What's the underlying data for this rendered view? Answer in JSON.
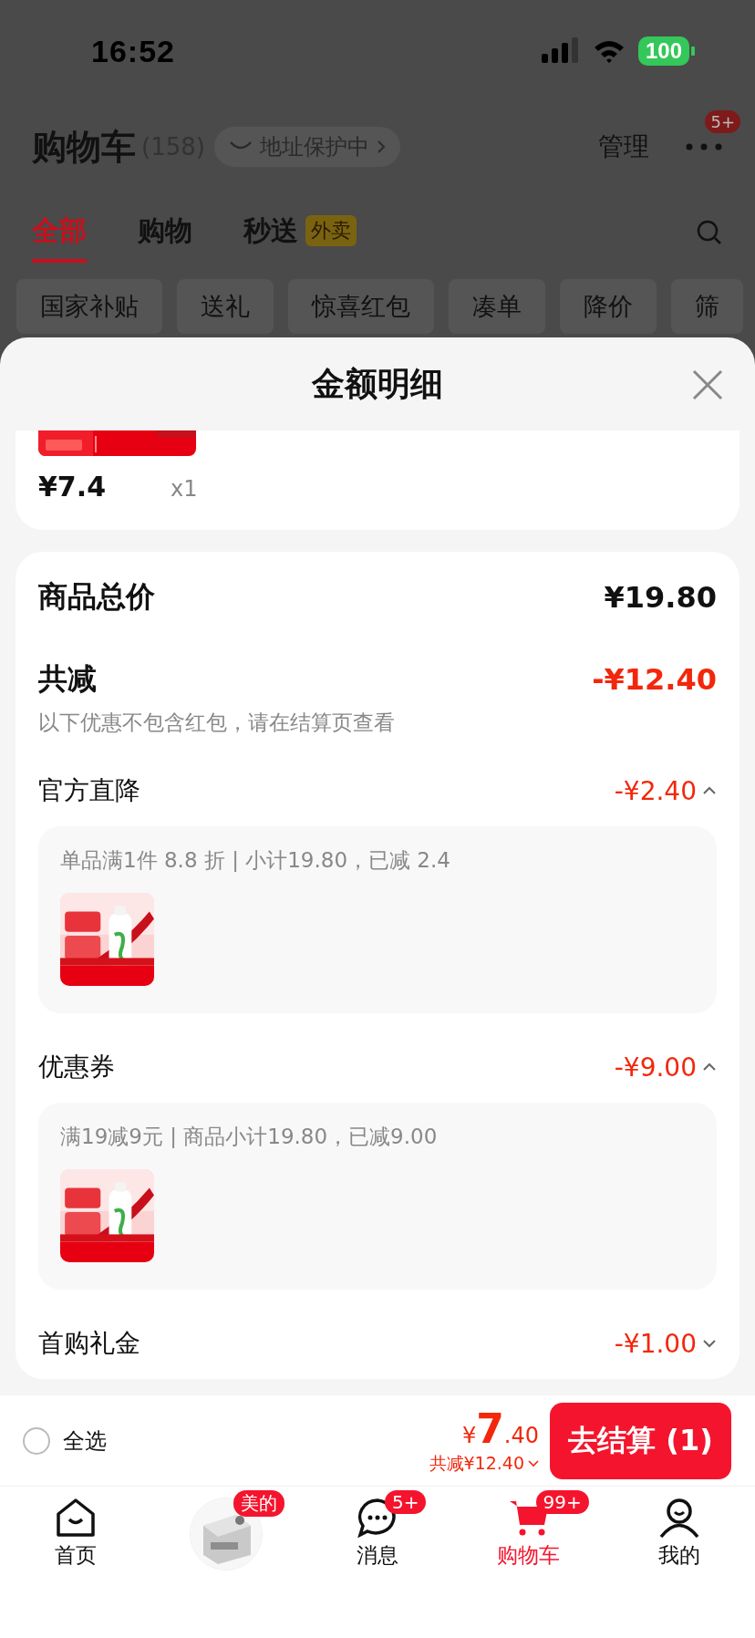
{
  "status_bar": {
    "time": "16:52",
    "battery": "100"
  },
  "header": {
    "title": "购物车",
    "count": "(158)",
    "address_pill": "地址保护中",
    "manage": "管理",
    "more_badge": "5+"
  },
  "tabs": [
    {
      "label": "全部",
      "selected": true
    },
    {
      "label": "购物",
      "selected": false
    },
    {
      "label": "秒送",
      "tag": "外卖",
      "selected": false
    }
  ],
  "chips": [
    "国家补贴",
    "送礼",
    "惊喜红包",
    "凑单",
    "降价",
    "筛"
  ],
  "sheet": {
    "title": "金额明细",
    "item": {
      "price": "¥7.4",
      "quantity": "x1"
    },
    "total": {
      "label": "商品总价",
      "value": "¥19.80"
    },
    "reduction": {
      "label": "共减",
      "value": "-¥12.40",
      "note": "以下优惠不包含红包，请在结算页查看"
    },
    "discounts": [
      {
        "label": "官方直降",
        "value": "-¥2.40",
        "expanded": true,
        "detail": "单品满1件 8.8 折 | 小计19.80，已减 2.4"
      },
      {
        "label": "优惠券",
        "value": "-¥9.00",
        "expanded": true,
        "detail": "满19减9元 | 商品小计19.80，已减9.00"
      },
      {
        "label": "首购礼金",
        "value": "-¥1.00",
        "expanded": false
      }
    ]
  },
  "checkout": {
    "select_all": {
      "label": "全选",
      "checked": false
    },
    "price_symbol": "¥",
    "price_integer": "7",
    "price_decimal": ".40",
    "saving": "共减¥12.40",
    "button": "去结算 (1)"
  },
  "tab_bar": [
    {
      "kind": "home",
      "label": "首页",
      "selected": false
    },
    {
      "kind": "promo",
      "badge": "美的",
      "selected": false
    },
    {
      "kind": "message",
      "label": "消息",
      "badge": "5+",
      "selected": false
    },
    {
      "kind": "cart",
      "label": "购物车",
      "badge": "99+",
      "selected": true
    },
    {
      "kind": "profile",
      "label": "我的",
      "selected": false
    }
  ]
}
